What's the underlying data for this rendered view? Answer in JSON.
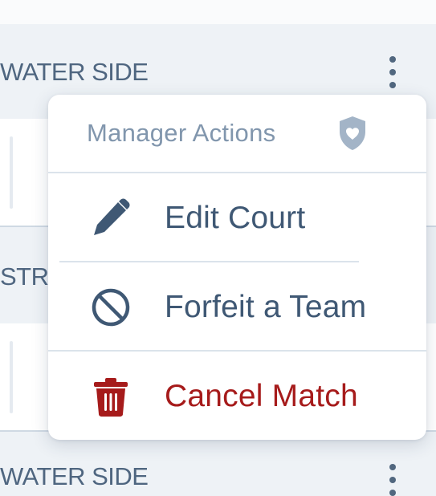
{
  "list": {
    "section_label_1": "WATER SIDE",
    "section_label_2": "STR",
    "section_label_3": "WATER SIDE"
  },
  "menu": {
    "title": "Manager Actions",
    "items": [
      {
        "label": "Edit Court",
        "icon": "pencil-icon"
      },
      {
        "label": "Forfeit a Team",
        "icon": "prohibited-icon"
      },
      {
        "label": "Cancel Match",
        "icon": "trash-icon"
      }
    ]
  },
  "colors": {
    "text_primary": "#3f5874",
    "text_muted": "#8196ad",
    "danger": "#a61b1b",
    "background": "#eef2f6",
    "divider": "#dbe3eb"
  }
}
